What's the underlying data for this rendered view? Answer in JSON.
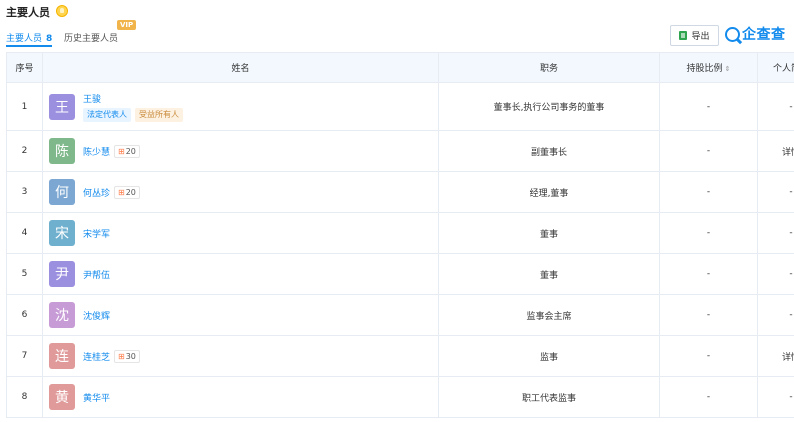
{
  "header": {
    "title": "主要人员",
    "tabs": [
      {
        "label": "主要人员",
        "count": "8"
      },
      {
        "label": "历史主要人员",
        "badge": "VIP"
      }
    ],
    "export_label": "导出",
    "logo_text": "企查查"
  },
  "table": {
    "columns": [
      "序号",
      "姓名",
      "职务",
      "持股比例",
      "个人简介"
    ],
    "sort_icon": "⇕",
    "rows": [
      {
        "index": "1",
        "avatar_char": "王",
        "avatar_color": "#9b8fe0",
        "name": "王骏",
        "tags": [
          "法定代表人",
          "受益所有人"
        ],
        "position": "董事长,执行公司事务的董事",
        "share": "-",
        "bio": "-"
      },
      {
        "index": "2",
        "avatar_char": "陈",
        "avatar_color": "#7fb88a",
        "name": "陈少慧",
        "ext_count": "20",
        "position": "副董事长",
        "share": "-",
        "bio": "详情"
      },
      {
        "index": "3",
        "avatar_char": "何",
        "avatar_color": "#7ba7d2",
        "name": "何丛珍",
        "ext_count": "20",
        "position": "经理,董事",
        "share": "-",
        "bio": "-"
      },
      {
        "index": "4",
        "avatar_char": "宋",
        "avatar_color": "#6fb0cf",
        "name": "宋学军",
        "position": "董事",
        "share": "-",
        "bio": "-"
      },
      {
        "index": "5",
        "avatar_char": "尹",
        "avatar_color": "#9b8fe0",
        "name": "尹帮伍",
        "position": "董事",
        "share": "-",
        "bio": "-"
      },
      {
        "index": "6",
        "avatar_char": "沈",
        "avatar_color": "#c79bd6",
        "name": "沈俊辉",
        "position": "监事会主席",
        "share": "-",
        "bio": "-"
      },
      {
        "index": "7",
        "avatar_char": "连",
        "avatar_color": "#e09a9a",
        "name": "连桂芝",
        "ext_count": "30",
        "position": "监事",
        "share": "-",
        "bio": "详情"
      },
      {
        "index": "8",
        "avatar_char": "黄",
        "avatar_color": "#e09a9a",
        "name": "黄华平",
        "position": "职工代表监事",
        "share": "-",
        "bio": "-"
      }
    ]
  },
  "icons": {
    "bell": "bell-icon",
    "export": "excel-icon",
    "logo": "qichacha-logo-icon",
    "ext": "network-icon"
  }
}
